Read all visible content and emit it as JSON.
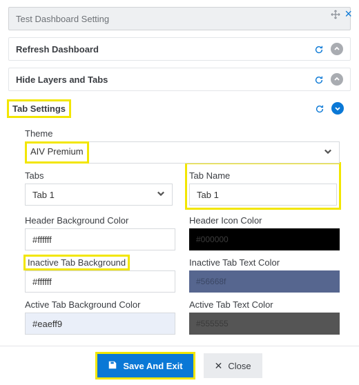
{
  "window": {
    "title": "Test Dashboard Setting"
  },
  "accordions": {
    "refresh": "Refresh Dashboard",
    "hide": "Hide Layers and Tabs",
    "tabs": "Tab Settings"
  },
  "theme": {
    "label": "Theme",
    "value": "AIV Premium"
  },
  "tabs_select": {
    "label": "Tabs",
    "value": "Tab 1"
  },
  "tab_name": {
    "label": "Tab Name",
    "value": "Tab 1"
  },
  "header_bg": {
    "label": "Header Background Color",
    "value": "#ffffff"
  },
  "header_icon": {
    "label": "Header Icon Color",
    "value": "#000000"
  },
  "inactive_bg": {
    "label": "Inactive Tab Background",
    "value": "#ffffff"
  },
  "inactive_tx": {
    "label": "Inactive Tab Text Color",
    "value": "#56668f"
  },
  "active_bg": {
    "label": "Active Tab Background Color",
    "value": "#eaeff9"
  },
  "active_tx": {
    "label": "Active Tab Text Color",
    "value": "#555555"
  },
  "footer": {
    "save": "Save And Exit",
    "close": "Close"
  }
}
